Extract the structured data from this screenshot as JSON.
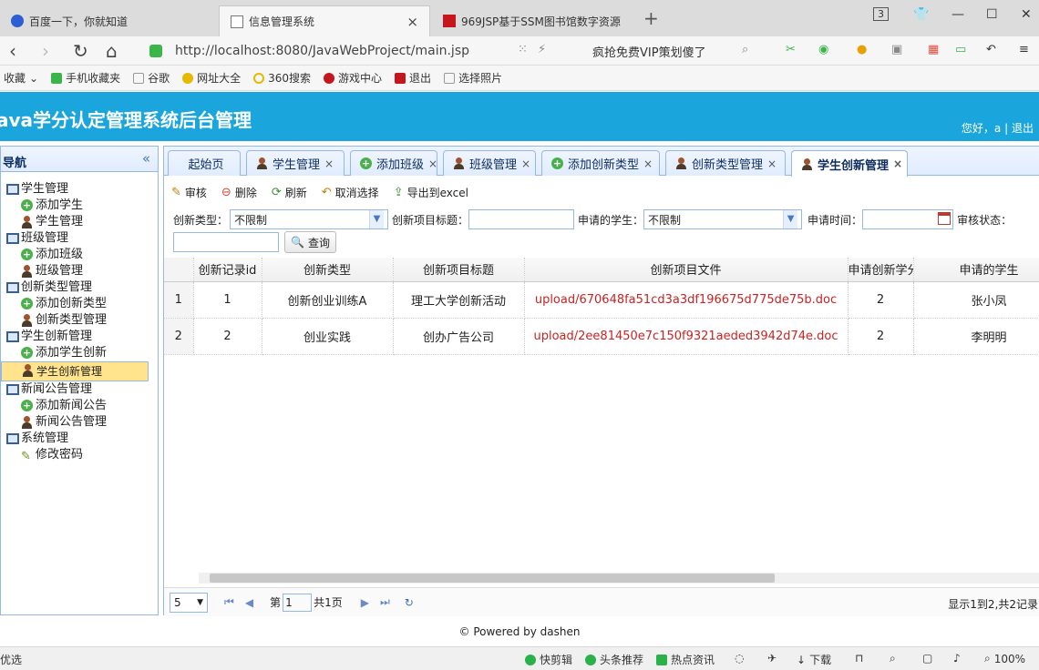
{
  "browser": {
    "tabs": [
      {
        "label": "百度一下，你就知道",
        "icon": "baidu-paw-icon"
      },
      {
        "label": "信息管理系统",
        "icon": "document-icon",
        "close": "×"
      },
      {
        "label": "969JSP基于SSM图书馆数字资源",
        "icon": "red-flag-icon"
      }
    ],
    "new_tab": "+",
    "tab_count": "3",
    "url": "http://localhost:8080/JavaWebProject/main.jsp",
    "promo": "疯抢免费VIP策划傻了",
    "favorites": [
      "收藏",
      "手机收藏夹",
      "谷歌",
      "网址大全",
      "360搜索",
      "游戏中心",
      "退出",
      "选择照片"
    ]
  },
  "header": {
    "title": "ava学分认定管理系统后台管理",
    "greeting": "您好，a",
    "separator": "|",
    "logout": "退出"
  },
  "sidebar": {
    "title": "导航",
    "collapse": "«",
    "groups": [
      {
        "label": "学生管理",
        "children": [
          {
            "label": "添加学生",
            "icon": "add"
          },
          {
            "label": "学生管理",
            "icon": "person"
          }
        ]
      },
      {
        "label": "班级管理",
        "children": [
          {
            "label": "添加班级",
            "icon": "add"
          },
          {
            "label": "班级管理",
            "icon": "person"
          }
        ]
      },
      {
        "label": "创新类型管理",
        "children": [
          {
            "label": "添加创新类型",
            "icon": "add"
          },
          {
            "label": "创新类型管理",
            "icon": "person"
          }
        ]
      },
      {
        "label": "学生创新管理",
        "children": [
          {
            "label": "添加学生创新",
            "icon": "add"
          },
          {
            "label": "学生创新管理",
            "icon": "person",
            "selected": true
          }
        ]
      },
      {
        "label": "新闻公告管理",
        "children": [
          {
            "label": "添加新闻公告",
            "icon": "add"
          },
          {
            "label": "新闻公告管理",
            "icon": "person"
          }
        ]
      },
      {
        "label": "系统管理",
        "children": [
          {
            "label": "修改密码",
            "icon": "pencil"
          }
        ]
      }
    ]
  },
  "tabs": [
    {
      "label": "起始页"
    },
    {
      "label": "学生管理",
      "icon": "person",
      "close": "×"
    },
    {
      "label": "添加班级",
      "icon": "add",
      "close": "×"
    },
    {
      "label": "班级管理",
      "icon": "person",
      "close": "×"
    },
    {
      "label": "添加创新类型",
      "icon": "add",
      "close": "×"
    },
    {
      "label": "创新类型管理",
      "icon": "person",
      "close": "×"
    },
    {
      "label": "学生创新管理",
      "icon": "person",
      "close": "×",
      "active": true
    }
  ],
  "toolbar": {
    "audit": "审核",
    "delete": "删除",
    "refresh": "刷新",
    "cancel_select": "取消选择",
    "export": "导出到excel"
  },
  "search": {
    "type_label": "创新类型：",
    "type_value": "不限制",
    "title_label": "创新项目标题：",
    "title_value": "",
    "student_label": "申请的学生：",
    "student_value": "不限制",
    "time_label": "申请时间：",
    "time_value": "",
    "status_label": "审核状态：",
    "status_value": "",
    "query_button": "查询"
  },
  "table": {
    "columns": [
      "创新记录id",
      "创新类型",
      "创新项目标题",
      "创新项目文件",
      "申请创新学分",
      "申请的学生"
    ],
    "rows": [
      {
        "rn": "1",
        "id": "1",
        "type": "创新创业训练A",
        "title": "理工大学创新活动",
        "file": "upload/670648fa51cd3a3df196675d775de75b.doc",
        "credit": "2",
        "student": "张小凤"
      },
      {
        "rn": "2",
        "id": "2",
        "type": "创业实践",
        "title": "创办广告公司",
        "file": "upload/2ee81450e7c150f9321aeded3942d74e.doc",
        "credit": "2",
        "student": "李明明"
      }
    ]
  },
  "pager": {
    "page_size": "5",
    "page_prefix": "第",
    "page_value": "1",
    "page_total": "共1页",
    "summary": "显示1到2,共2记录"
  },
  "footer": {
    "text": "© Powered by dashen"
  },
  "statusbar": {
    "left": "优选",
    "items": [
      "快剪辑",
      "头条推荐",
      "热点资讯",
      "下载",
      "100%"
    ]
  },
  "colors": {
    "header_bg": "#1aa5dc",
    "panel_border": "#95b8e7",
    "file_link": "#cc2222",
    "selected_node": "#ffe48d"
  }
}
